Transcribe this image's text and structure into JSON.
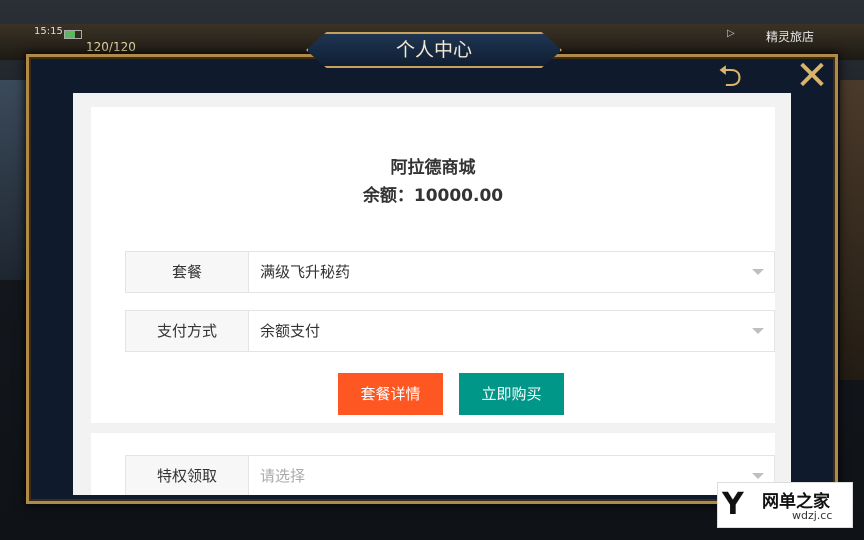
{
  "hud": {
    "time": "15:15",
    "hp": "120/120",
    "inn": "精灵旅店",
    "play_icon": "play-icon"
  },
  "dialog": {
    "title": "个人中心",
    "back_icon": "back-arrow-icon",
    "close_icon": "close-x-icon"
  },
  "shop": {
    "name": "阿拉德商城",
    "balance": "余额：10000.00"
  },
  "form": {
    "package_label": "套餐",
    "package_value": "满级飞升秘药",
    "payment_label": "支付方式",
    "payment_value": "余额支付",
    "privilege_label": "特权领取",
    "privilege_placeholder": "请选择"
  },
  "buttons": {
    "detail": "套餐详情",
    "buy": "立即购买"
  },
  "colors": {
    "detail_button": "#ff5722",
    "buy_button": "#009688",
    "frame_gold": "#b08a4a"
  },
  "watermark": {
    "name": "网单之家",
    "url": "wdzj.cc"
  }
}
